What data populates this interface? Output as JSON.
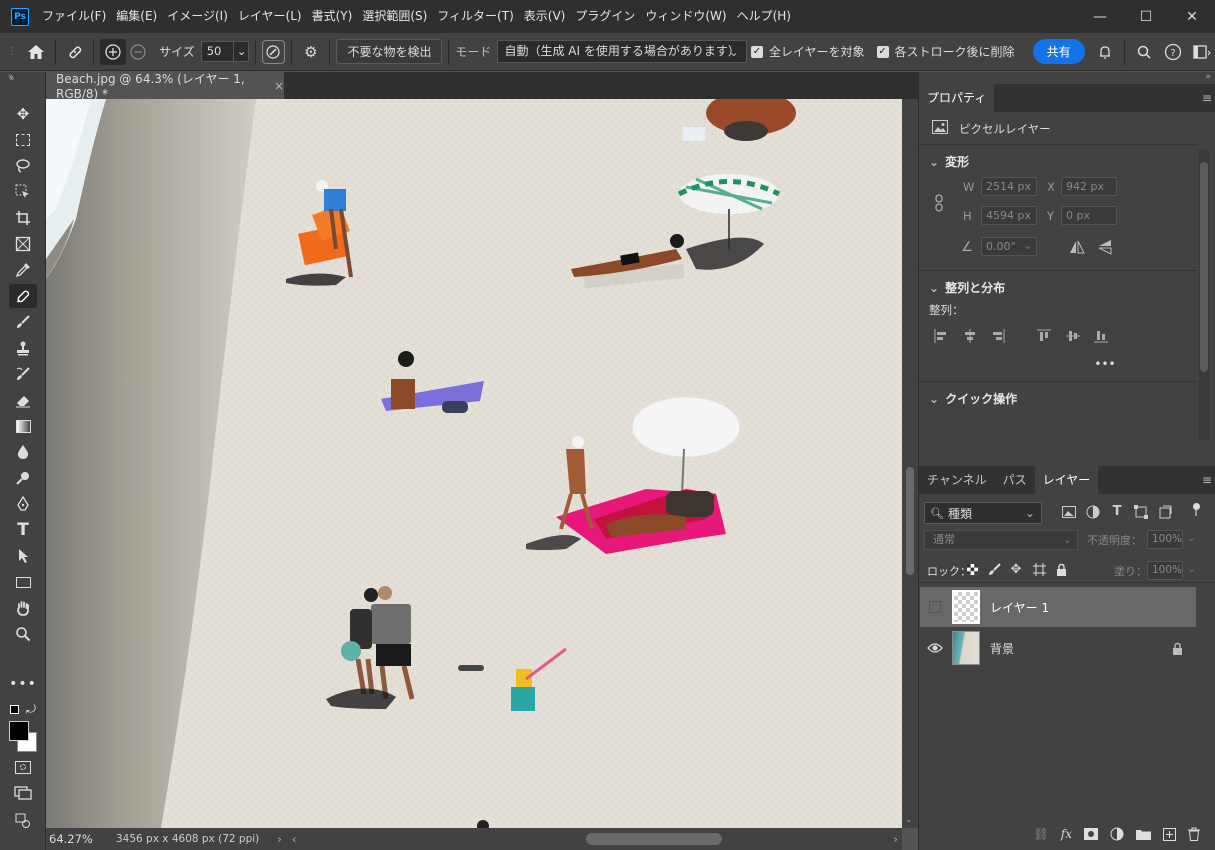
{
  "app": {
    "logo": "Ps"
  },
  "menu": [
    "ファイル(F)",
    "編集(E)",
    "イメージ(I)",
    "レイヤー(L)",
    "書式(Y)",
    "選択範囲(S)",
    "フィルター(T)",
    "表示(V)",
    "プラグイン",
    "ウィンドウ(W)",
    "ヘルプ(H)"
  ],
  "window_controls": {
    "minimize": "—",
    "maximize": "☐",
    "close": "✕"
  },
  "options": {
    "size_label": "サイズ",
    "size_value": "50",
    "detect_button": "不要な物を検出",
    "mode_label": "モード",
    "mode_value": "自動（生成 AI を使用する場合があります）",
    "check_all_layers": "全レイヤーを対象",
    "check_delete_after_stroke": "各ストローク後に削除",
    "share_button": "共有"
  },
  "document": {
    "tab_title": "Beach.jpg @ 64.3% (レイヤー 1, RGB/8) *",
    "zoom": "64.27%",
    "info": "3456 px x 4608 px (72 ppi)"
  },
  "properties": {
    "tab": "プロパティ",
    "layer_type": "ピクセルレイヤー",
    "transform_header": "変形",
    "w_label": "W",
    "w_value": "2514 px",
    "x_label": "X",
    "x_value": "942 px",
    "h_label": "H",
    "h_value": "4594 px",
    "y_label": "Y",
    "y_value": "0 px",
    "angle_value": "0.00°",
    "align_header": "整列と分布",
    "align_label": "整列：",
    "quick_header": "クイック操作"
  },
  "layers_panel": {
    "tabs": [
      "チャンネル",
      "パス",
      "レイヤー"
    ],
    "filter_value": "種類",
    "blend_mode": "通常",
    "opacity_label": "不透明度：",
    "opacity_value": "100%",
    "lock_label": "ロック：",
    "fill_label": "塗り：",
    "fill_value": "100%",
    "layers": [
      {
        "name": "レイヤー 1"
      },
      {
        "name": "背景"
      }
    ]
  },
  "colors": {
    "accent": "#1473e6",
    "panel": "#424242",
    "canvas": "#dcd8cf"
  },
  "icons": [
    "home-icon",
    "spot-healing-icon",
    "add-brush-icon",
    "subtract-brush-icon",
    "gear-icon",
    "bell-icon",
    "search-icon",
    "help-icon",
    "workspace-icon"
  ]
}
